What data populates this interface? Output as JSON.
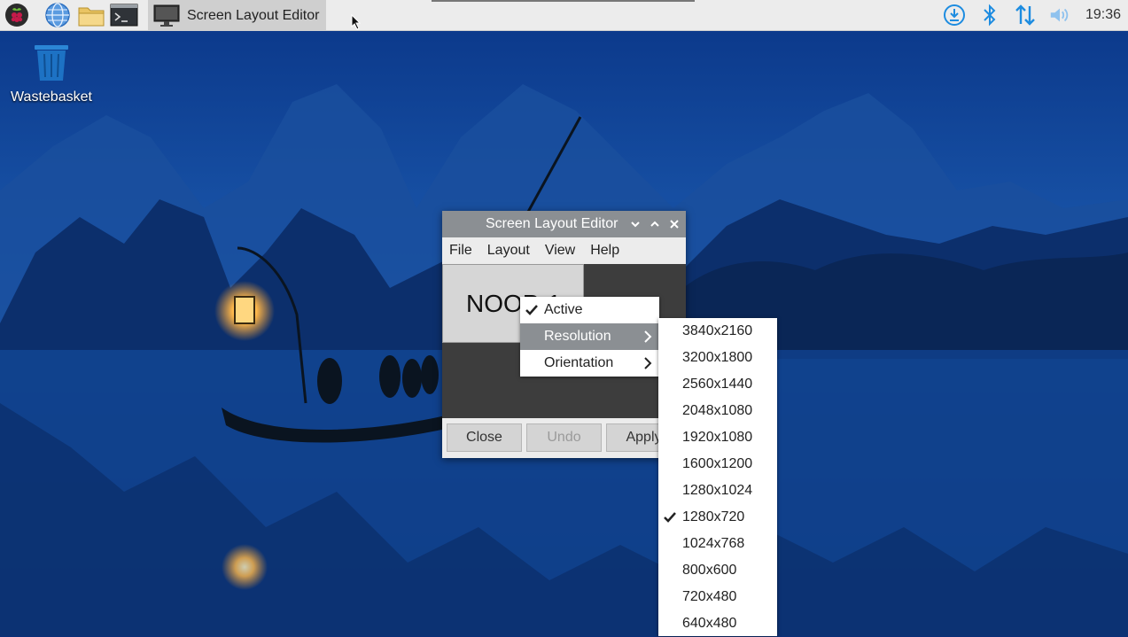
{
  "taskbar": {
    "task_title": "Screen Layout Editor",
    "clock": "19:36"
  },
  "desktop": {
    "wastebasket_label": "Wastebasket"
  },
  "window": {
    "title": "Screen Layout Editor",
    "menu": [
      "File",
      "Layout",
      "View",
      "Help"
    ],
    "monitor_label": "NOOP-1",
    "buttons": {
      "close": "Close",
      "undo": "Undo",
      "apply": "Apply"
    }
  },
  "context_menu": {
    "items": [
      {
        "label": "Active",
        "checked": true
      },
      {
        "label": "Resolution",
        "submenu": true,
        "highlighted": true
      },
      {
        "label": "Orientation",
        "submenu": true
      }
    ]
  },
  "resolution_menu": {
    "items": [
      "3840x2160",
      "3200x1800",
      "2560x1440",
      "2048x1080",
      "1920x1080",
      "1600x1200",
      "1280x1024",
      "1280x720",
      "1024x768",
      "800x600",
      "720x480",
      "640x480"
    ],
    "selected": "1280x720"
  },
  "colors": {
    "taskbar_bg": "#ececec",
    "titlebar_bg": "#8b8f93",
    "highlight_bg": "#8b8f93",
    "tray_blue": "#1d8ce0"
  }
}
